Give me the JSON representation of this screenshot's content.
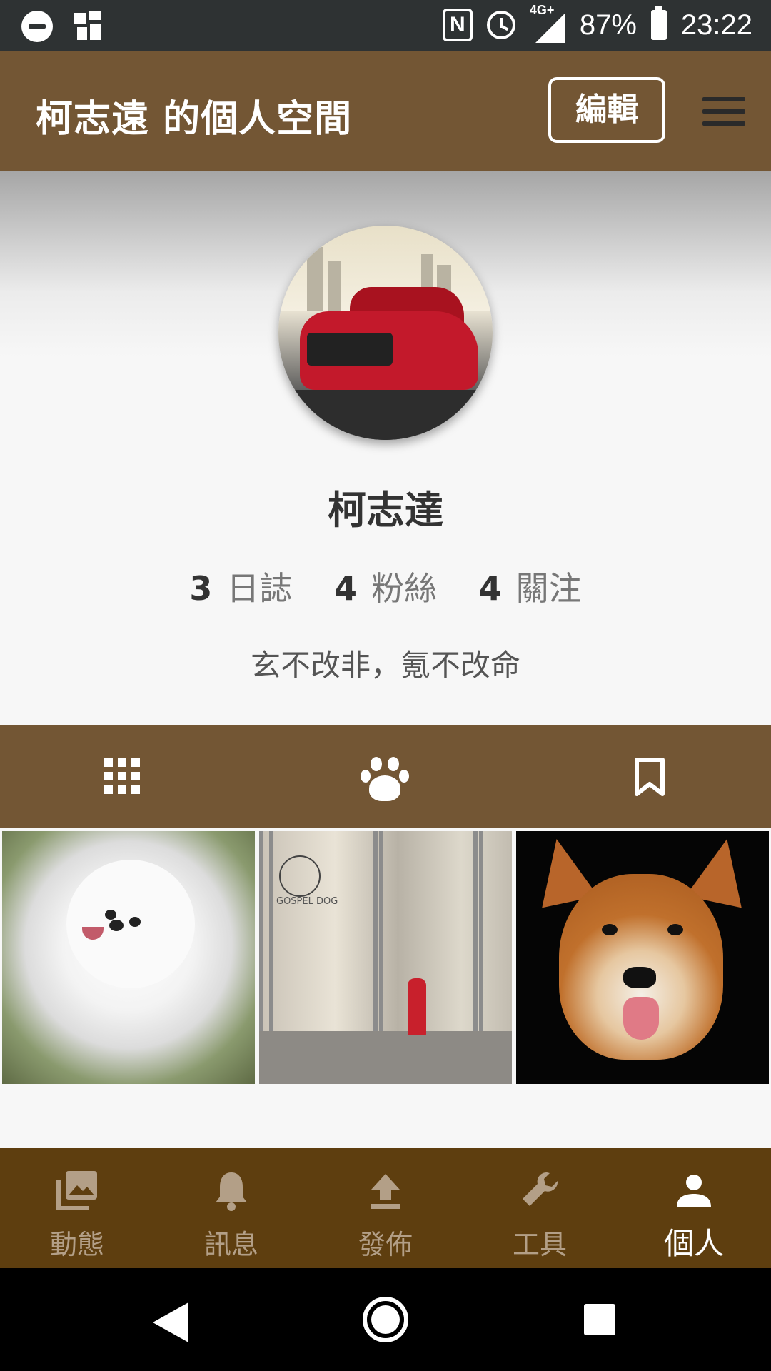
{
  "status_bar": {
    "network": "4G+",
    "battery": "87%",
    "time": "23:22",
    "icons": [
      "do-not-disturb-icon",
      "image-notification-icon",
      "nfc-icon",
      "alarm-icon",
      "signal-icon",
      "battery-icon"
    ]
  },
  "header": {
    "title": "柯志遠 的個人空間",
    "edit_label": "編輯",
    "menu_icon": "hamburger-menu-icon"
  },
  "profile": {
    "name": "柯志達",
    "stats": [
      {
        "count": "3",
        "label": "日誌"
      },
      {
        "count": "4",
        "label": "粉絲"
      },
      {
        "count": "4",
        "label": "關注"
      }
    ],
    "bio": "玄不改非，氪不改命",
    "avatar_icon": "profile-avatar-car"
  },
  "tabs": [
    {
      "icon": "grid-icon"
    },
    {
      "icon": "paw-icon",
      "active": true
    },
    {
      "icon": "bookmark-icon"
    }
  ],
  "photos": [
    {
      "subject": "white-pomeranian"
    },
    {
      "subject": "pet-shop-entrance",
      "sign_text": "GOSPEL DOG"
    },
    {
      "subject": "shiba-inu"
    }
  ],
  "bottom_nav": [
    {
      "label": "動態",
      "icon": "photo-library-icon"
    },
    {
      "label": "訊息",
      "icon": "bell-icon"
    },
    {
      "label": "發佈",
      "icon": "upload-icon"
    },
    {
      "label": "工具",
      "icon": "wrench-icon"
    },
    {
      "label": "個人",
      "icon": "person-icon",
      "active": true
    }
  ],
  "colors": {
    "header_bg": "#735634",
    "bottom_nav_bg": "#5e3e0f",
    "nav_inactive": "#b39f87",
    "nav_active": "#ffffff"
  }
}
